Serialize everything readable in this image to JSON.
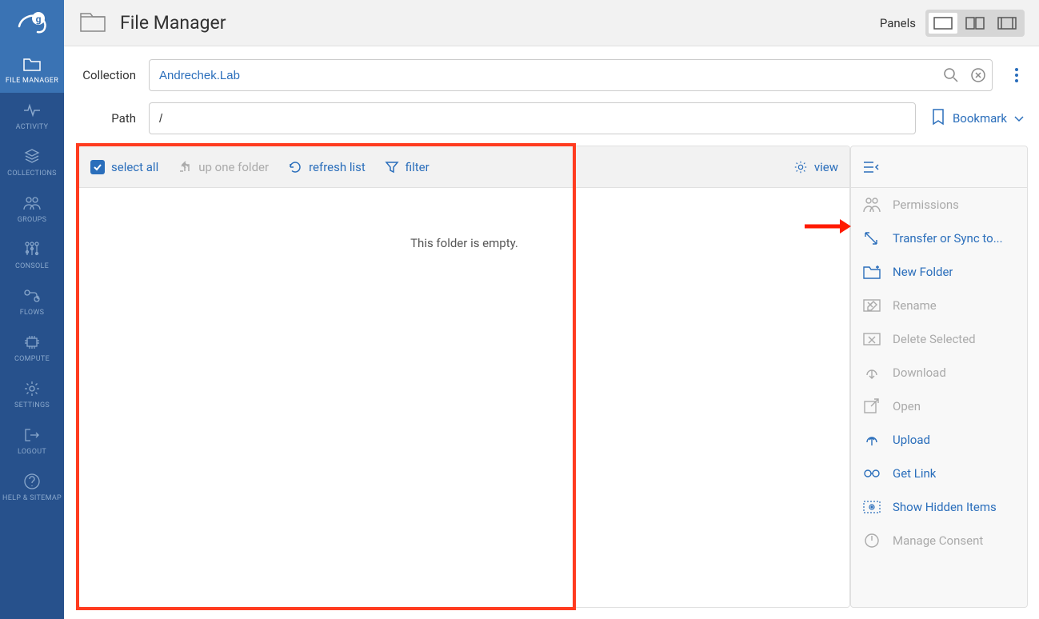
{
  "header": {
    "title": "File Manager",
    "panels_label": "Panels"
  },
  "sidebar": {
    "items": [
      {
        "label": "FILE MANAGER"
      },
      {
        "label": "ACTIVITY"
      },
      {
        "label": "COLLECTIONS"
      },
      {
        "label": "GROUPS"
      },
      {
        "label": "CONSOLE"
      },
      {
        "label": "FLOWS"
      },
      {
        "label": "COMPUTE"
      },
      {
        "label": "SETTINGS"
      },
      {
        "label": "LOGOUT"
      },
      {
        "label": "HELP & SITEMAP"
      }
    ]
  },
  "fields": {
    "collection_label": "Collection",
    "collection_value": "Andrechek.Lab",
    "path_label": "Path",
    "path_value": "/",
    "bookmark_label": "Bookmark"
  },
  "toolbar": {
    "select_all": "select all",
    "up_one": "up one folder",
    "refresh": "refresh list",
    "filter": "filter",
    "view": "view"
  },
  "folder_empty": "This folder is empty.",
  "actions": {
    "items": [
      {
        "label": "Permissions",
        "enabled": false,
        "icon": "users"
      },
      {
        "label": "Transfer or Sync to...",
        "enabled": true,
        "icon": "transfer"
      },
      {
        "label": "New Folder",
        "enabled": true,
        "icon": "new-folder"
      },
      {
        "label": "Rename",
        "enabled": false,
        "icon": "rename"
      },
      {
        "label": "Delete Selected",
        "enabled": false,
        "icon": "delete"
      },
      {
        "label": "Download",
        "enabled": false,
        "icon": "download"
      },
      {
        "label": "Open",
        "enabled": false,
        "icon": "open"
      },
      {
        "label": "Upload",
        "enabled": true,
        "icon": "upload"
      },
      {
        "label": "Get Link",
        "enabled": true,
        "icon": "link"
      },
      {
        "label": "Show Hidden Items",
        "enabled": true,
        "icon": "eye"
      },
      {
        "label": "Manage Consent",
        "enabled": false,
        "icon": "power"
      }
    ]
  }
}
